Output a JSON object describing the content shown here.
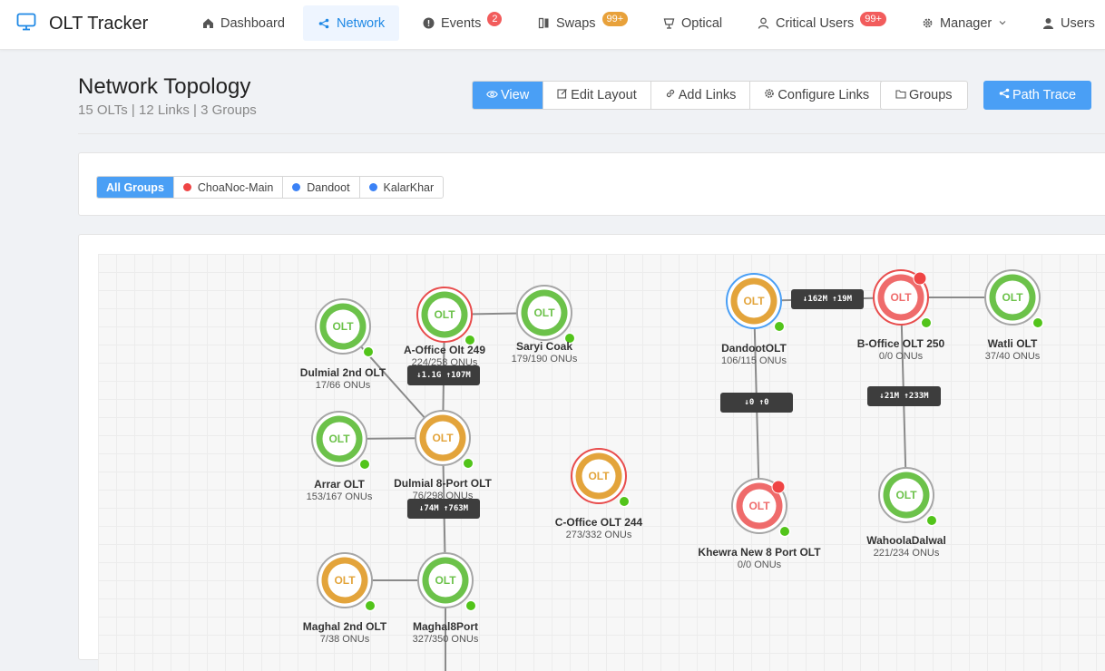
{
  "app": {
    "title": "OLT Tracker",
    "logo_icon": "monitor-icon"
  },
  "nav": [
    {
      "label": "Dashboard",
      "icon": "home-icon"
    },
    {
      "label": "Network",
      "icon": "share-icon",
      "active": true
    },
    {
      "label": "Events",
      "icon": "alert-icon",
      "badge": "2"
    },
    {
      "label": "Swaps",
      "icon": "swap-icon",
      "badge": "99+"
    },
    {
      "label": "Optical",
      "icon": "signal-icon"
    },
    {
      "label": "Critical Users",
      "icon": "user-icon",
      "badge": "99+"
    },
    {
      "label": "Manager",
      "icon": "gear-icon"
    },
    {
      "label": "Users",
      "icon": "person-icon"
    }
  ],
  "header": {
    "title": "Network Topology",
    "subtitle": "15 OLTs | 12 Links | 3 Groups"
  },
  "toolbar": {
    "modes": [
      "View",
      "Edit Layout",
      "Add Links",
      "Configure Links"
    ],
    "groups_label": "Groups",
    "path_trace_label": "Path Trace"
  },
  "group_filter": [
    {
      "label": "All Groups"
    },
    {
      "label": "ChoaNoc-Main",
      "color": "#ef4444"
    },
    {
      "label": "Dandoot",
      "color": "#3b82f6"
    },
    {
      "label": "KalarKhar",
      "color": "#3b82f6"
    }
  ],
  "colors": {
    "accent": "#4a9ff5",
    "node_green": "#6cc24a",
    "node_orange": "#e3a43b",
    "node_red": "#ef6b6b",
    "ring_gray": "#a6a6a6",
    "ring_red": "#e84c4c",
    "ring_blue": "#4a9ff5",
    "link_label_bg": "#3d3d3d"
  },
  "topology": {
    "node_badge": "OLT",
    "nodes": [
      {
        "name": "Dulmial 2nd OLT",
        "onus": "17/66 ONUs",
        "status": "green",
        "ring": "gray"
      },
      {
        "name": "A-Office Olt 249",
        "onus": "224/258 ONUs",
        "status": "green",
        "ring": "red"
      },
      {
        "name": "Saryi Coak",
        "onus": "179/190 ONUs",
        "status": "green",
        "ring": "gray"
      },
      {
        "name": "Arrar OLT",
        "onus": "153/167 ONUs",
        "status": "green",
        "ring": "gray"
      },
      {
        "name": "Dulmial 8-Port OLT",
        "onus": "76/298 ONUs",
        "status": "orange",
        "ring": "gray"
      },
      {
        "name": "C-Office OLT 244",
        "onus": "273/332 ONUs",
        "status": "orange",
        "ring": "red"
      },
      {
        "name": "Maghal 2nd OLT",
        "onus": "7/38 ONUs",
        "status": "orange",
        "ring": "gray"
      },
      {
        "name": "Maghal8Port",
        "onus": "327/350 ONUs",
        "status": "green",
        "ring": "gray"
      },
      {
        "name": "DandootOLT",
        "onus": "106/115 ONUs",
        "status": "orange",
        "ring": "blue"
      },
      {
        "name": "B-Office OLT 250",
        "onus": "0/0 ONUs",
        "status": "red",
        "ring": "red",
        "alert": true
      },
      {
        "name": "Watli OLT",
        "onus": "37/40 ONUs",
        "status": "green",
        "ring": "gray"
      },
      {
        "name": "Khewra New 8 Port OLT",
        "onus": "0/0 ONUs",
        "status": "red",
        "ring": "gray",
        "alert": true
      },
      {
        "name": "WahoolaDalwal",
        "onus": "221/234 ONUs",
        "status": "green",
        "ring": "gray"
      }
    ],
    "link_labels": [
      {
        "text": "↓1.1G ↑107M"
      },
      {
        "text": "↓74M ↑763M"
      },
      {
        "text": "↓162M ↑19M"
      },
      {
        "text": "↓0 ↑0"
      },
      {
        "text": "↓21M ↑233M"
      }
    ]
  }
}
